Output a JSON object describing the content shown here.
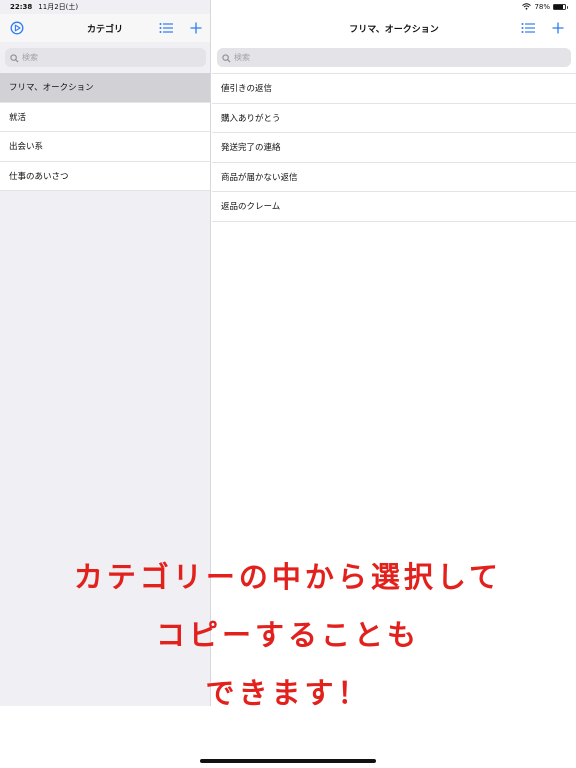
{
  "status": {
    "time": "22:38",
    "date": "11月2日(土)",
    "battery": "78%"
  },
  "sidebar": {
    "title": "カテゴリ",
    "search_placeholder": "検索",
    "items": [
      {
        "label": "フリマ、オークション",
        "selected": true
      },
      {
        "label": "就活"
      },
      {
        "label": "出会い系"
      },
      {
        "label": "仕事のあいさつ"
      }
    ]
  },
  "detail": {
    "title": "フリマ、オークション",
    "search_placeholder": "検索",
    "items": [
      {
        "label": "値引きの返信"
      },
      {
        "label": "購入ありがとう"
      },
      {
        "label": "発送完了の連絡"
      },
      {
        "label": "商品が届かない返信"
      },
      {
        "label": "返品のクレーム"
      }
    ]
  },
  "overlay": {
    "lines": [
      "カテゴリーの中から選択して",
      "コピーすることも",
      "できます！"
    ]
  },
  "colors": {
    "accent": "#2f7bf5",
    "overlay_text": "#e2211c"
  }
}
